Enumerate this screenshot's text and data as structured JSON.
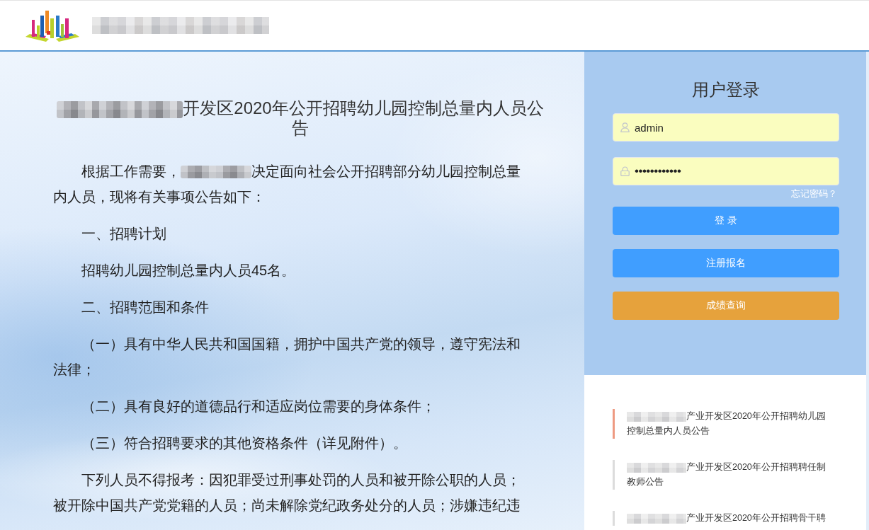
{
  "header": {
    "site_name": [
      {
        "kind": "redacted"
      }
    ]
  },
  "article": {
    "title": [
      {
        "kind": "redacted"
      },
      {
        "kind": "text",
        "text": "开发区2020年公开招聘幼儿园控制总量内人员公告"
      }
    ],
    "paragraphs": [
      {
        "segments": [
          {
            "kind": "text",
            "text": "根据工作需要，"
          },
          {
            "kind": "redacted"
          },
          {
            "kind": "text",
            "text": "决定面向社会公开招聘部分幼儿园控制总量内人员，现将有关事项公告如下："
          }
        ]
      },
      {
        "segments": [
          {
            "kind": "text",
            "text": "一、招聘计划"
          }
        ]
      },
      {
        "segments": [
          {
            "kind": "text",
            "text": "招聘幼儿园控制总量内人员45名。"
          }
        ]
      },
      {
        "segments": [
          {
            "kind": "text",
            "text": "二、招聘范围和条件"
          }
        ]
      },
      {
        "segments": [
          {
            "kind": "text",
            "text": "（一）具有中华人民共和国国籍，拥护中国共产党的领导，遵守宪法和法律；"
          }
        ]
      },
      {
        "segments": [
          {
            "kind": "text",
            "text": "（二）具有良好的道德品行和适应岗位需要的身体条件；"
          }
        ]
      },
      {
        "segments": [
          {
            "kind": "text",
            "text": "（三）符合招聘要求的其他资格条件（详见附件）。"
          }
        ]
      },
      {
        "segments": [
          {
            "kind": "text",
            "text": "下列人员不得报考：因犯罪受过刑事处罚的人员和被开除公职的人员；被开除中国共产党党籍的人员；尚未解除党纪政务处分的人员；涉嫌违纪违"
          }
        ]
      }
    ]
  },
  "login": {
    "title": "用户登录",
    "username": {
      "value": "admin"
    },
    "password": {
      "value": "••••••••••••"
    },
    "forgot_link": "忘记密码？",
    "buttons": [
      {
        "label": "登 录",
        "kind": "primary"
      },
      {
        "label": "注册报名",
        "kind": "primary"
      },
      {
        "label": "成绩查询",
        "kind": "warning"
      }
    ]
  },
  "notices": [
    {
      "segments": [
        {
          "kind": "redacted"
        },
        {
          "kind": "text",
          "text": "产业开发区2020年公开招聘幼儿园控制总量内人员公告"
        }
      ],
      "selected": true
    },
    {
      "segments": [
        {
          "kind": "redacted"
        },
        {
          "kind": "text",
          "text": "产业开发区2020年公开招聘聘任制教师公告"
        }
      ],
      "selected": false
    },
    {
      "segments": [
        {
          "kind": "redacted"
        },
        {
          "kind": "text",
          "text": "产业开发区2020年公开招聘骨干聘"
        }
      ],
      "selected": false
    }
  ]
}
